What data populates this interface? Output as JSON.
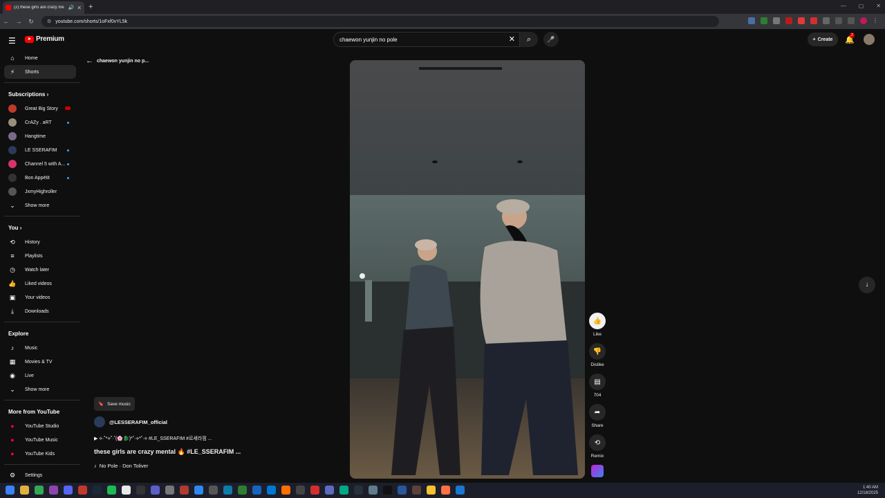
{
  "browser": {
    "tab_title": "(2) these girls are crazy me",
    "url": "youtube.com/shorts/1oFxf0vYL5k"
  },
  "topbar": {
    "logo_text": "Premium",
    "search_query": "chaewon yunjin no pole",
    "create_label": "Create",
    "notification_count": "2"
  },
  "sidebar": {
    "main": [
      {
        "label": "Home",
        "icon": "home-icon"
      },
      {
        "label": "Shorts",
        "icon": "shorts-icon",
        "active": true
      }
    ],
    "subscriptions_header": "Subscriptions",
    "subscriptions": [
      {
        "label": "Great Big Story",
        "color": "#c0392b",
        "indicator": "live"
      },
      {
        "label": "CrAZy . aRT",
        "color": "#9a8f7a",
        "indicator": "dot"
      },
      {
        "label": "Hangtime",
        "color": "#7a6a8a",
        "indicator": "none"
      },
      {
        "label": "LE SSERAFIM",
        "color": "#2a3b5a",
        "indicator": "dot"
      },
      {
        "label": "Channel 5 with A...",
        "color": "#d6336c",
        "indicator": "dot"
      },
      {
        "label": "Bon Appétit",
        "color": "#333333",
        "indicator": "dot"
      },
      {
        "label": "JxmyHighroller",
        "color": "#555555",
        "indicator": "none"
      }
    ],
    "show_more_1": "Show more",
    "you_header": "You",
    "you": [
      {
        "label": "History",
        "icon": "history-icon"
      },
      {
        "label": "Playlists",
        "icon": "playlists-icon"
      },
      {
        "label": "Watch later",
        "icon": "watch-later-icon"
      },
      {
        "label": "Liked videos",
        "icon": "liked-videos-icon"
      },
      {
        "label": "Your videos",
        "icon": "your-videos-icon"
      },
      {
        "label": "Downloads",
        "icon": "downloads-icon"
      }
    ],
    "explore_header": "Explore",
    "explore": [
      {
        "label": "Music",
        "icon": "music-icon"
      },
      {
        "label": "Movies & TV",
        "icon": "movies-icon"
      },
      {
        "label": "Live",
        "icon": "live-icon"
      }
    ],
    "show_more_2": "Show more",
    "more_header": "More from YouTube",
    "more": [
      {
        "label": "YouTube Studio"
      },
      {
        "label": "YouTube Music"
      },
      {
        "label": "YouTube Kids"
      }
    ],
    "settings_label": "Settings"
  },
  "main": {
    "back_label": "chaewon yunjin no p...",
    "save_music_label": "Save music",
    "channel_handle": "@LESSERAFIM_official",
    "description_line1": "▶ ⟡·˚*⟡˚·˚(🌸🐉)*˚·⟡*˚·⟡ #LE_SSERAFIM #르세라핌 ...",
    "description_line2": "these girls are crazy mental 🔥 #LE_SSERAFIM ...",
    "music_note": "♪",
    "music_label": "No Pole · Don Toliver"
  },
  "actions": {
    "like_label": "Like",
    "dislike_label": "Dislike",
    "comments_count": "704",
    "share_label": "Share",
    "remix_label": "Remix"
  },
  "taskbar": {
    "time": "1:40 AM",
    "date": "12/18/2025"
  }
}
